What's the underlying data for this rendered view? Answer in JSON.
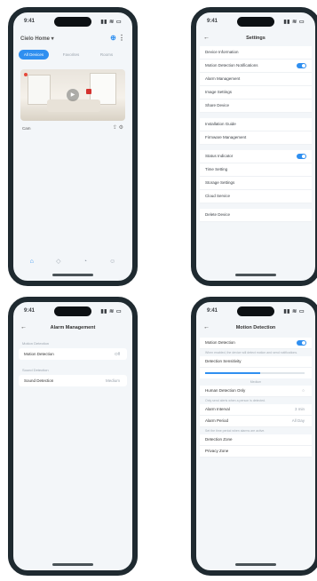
{
  "phone1": {
    "status": {
      "time": "9:41",
      "signals": "▮▮ ≋ ▭"
    },
    "header": {
      "home_name": "Cielo Home ▾",
      "add_icon": "plus-icon",
      "menu_icon": "more-icon"
    },
    "tabs": [
      "All Devices",
      "Favorites",
      "Rooms"
    ],
    "camera": {
      "name": "Cam",
      "play_icon": "play-icon"
    },
    "nav": [
      {
        "icon": "home-icon",
        "label": ""
      },
      {
        "icon": "scene-icon",
        "label": ""
      },
      {
        "icon": "alarm-icon",
        "label": ""
      },
      {
        "icon": "profile-icon",
        "label": ""
      }
    ]
  },
  "phone2": {
    "status": {
      "time": "9:41",
      "signals": "▮▮ ≋ ▭"
    },
    "title": "Settings",
    "rows": [
      {
        "label": "Device Information",
        "toggle": false
      },
      {
        "label": "Motion Detection Notifications",
        "toggle": true
      },
      {
        "label": "Alarm Management",
        "toggle": false
      },
      {
        "label": "Image Settings",
        "toggle": false
      },
      {
        "label": "Share Device",
        "toggle": false
      },
      {
        "gap": true
      },
      {
        "label": "Installation Guide",
        "toggle": false
      },
      {
        "label": "Firmware Management",
        "toggle": false
      },
      {
        "gap": true
      },
      {
        "label": "Status Indicator",
        "toggle": true
      },
      {
        "label": "Time Setting",
        "toggle": false
      },
      {
        "label": "Storage Settings",
        "toggle": false
      },
      {
        "label": "Cloud Service",
        "toggle": false
      },
      {
        "gap": true
      },
      {
        "label": "Delete Device",
        "toggle": false
      }
    ]
  },
  "phone3": {
    "status": {
      "time": "9:41",
      "signals": "▮▮ ≋ ▭"
    },
    "title": "Alarm Management",
    "section1": "Motion Detection",
    "card1": {
      "label": "Motion Detection",
      "value": "Off"
    },
    "section2": "Sound Detection",
    "card2": {
      "label": "Sound Detection",
      "value": "Medium"
    }
  },
  "phone4": {
    "status": {
      "time": "9:41",
      "signals": "▮▮ ≋ ▭"
    },
    "title": "Motion Detection",
    "rows1": [
      {
        "label": "Motion Detection",
        "toggle": true
      }
    ],
    "note1": "When enabled, the device will detect motion and send notifications.",
    "label_sens": "Detection Sensitivity",
    "slider_value": 0.55,
    "slider_text": "Medium",
    "rows2": [
      {
        "label": "Human Detection Only",
        "toggle": false
      }
    ],
    "note2": "Only send alerts when a person is detected.",
    "rows3": [
      {
        "label": "Alarm Interval",
        "value": "3 min"
      },
      {
        "label": "Alarm Period",
        "value": "All Day"
      }
    ],
    "note3": "Set the time period when alarms are active.",
    "rows4": [
      {
        "label": "Detection Zone",
        "value": ""
      },
      {
        "label": "Privacy Zone",
        "value": ""
      }
    ]
  }
}
